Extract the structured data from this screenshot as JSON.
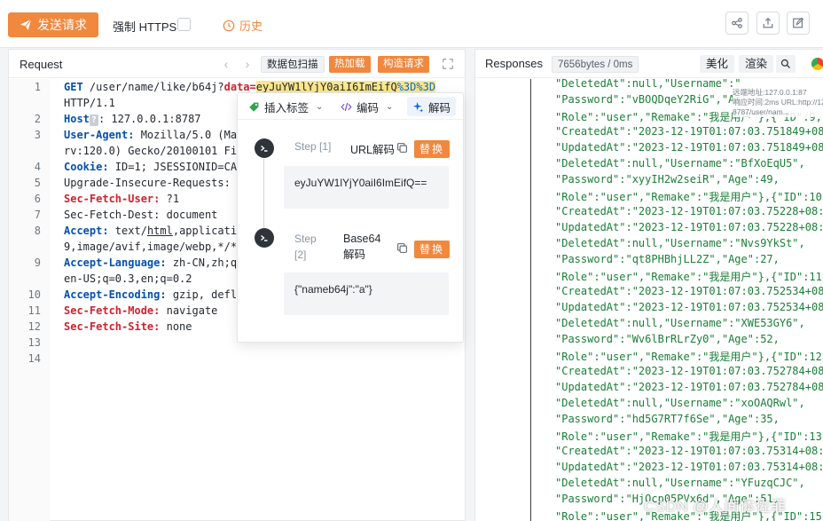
{
  "toolbar": {
    "send_label": "发送请求",
    "https_label": "强制 HTTPS",
    "https_checked": false,
    "history_label": "历史",
    "accent": "#f0883e"
  },
  "request": {
    "title": "Request",
    "buttons": {
      "scan": "数据包扫描",
      "hot_load": "热加载",
      "build": "构造请求"
    },
    "lines": [
      {
        "n": "1",
        "parts": [
          [
            "GET ",
            "k-blue"
          ],
          [
            "/user/name/like/b64j?",
            "k-plain"
          ],
          [
            "data=",
            "k-red"
          ],
          [
            "eyJuYW1lYjY0aiI6ImEifQ",
            "hl"
          ],
          [
            "%3D%3D",
            "hl-blue"
          ]
        ]
      },
      {
        "n": "",
        "parts": [
          [
            "HTTP/1.1",
            "k-plain"
          ]
        ]
      },
      {
        "n": "2",
        "parts": [
          [
            "Host",
            "k-blue"
          ]
        ],
        "badge": "?",
        "rest": [
          [
            ": 127.0.0.1:8787",
            "k-plain"
          ]
        ]
      },
      {
        "n": "3",
        "parts": [
          [
            "User-Agent:",
            "k-blue"
          ],
          [
            " Mozilla/5.0 (Ma",
            "k-plain"
          ]
        ]
      },
      {
        "n": "",
        "parts": [
          [
            "rv:120.0) Gecko/20100101 Fi",
            "k-plain"
          ]
        ]
      },
      {
        "n": "4",
        "parts": [
          [
            "Cookie:",
            "k-blue"
          ],
          [
            " ID=1; JSESSIONID=CA",
            "k-plain"
          ]
        ]
      },
      {
        "n": "5",
        "parts": [
          [
            "Upgrade-Insecure-Requests:",
            "k-plain"
          ]
        ]
      },
      {
        "n": "6",
        "parts": [
          [
            "Sec-Fetch-User:",
            "k-red"
          ],
          [
            " ?1",
            "k-plain"
          ]
        ]
      },
      {
        "n": "7",
        "parts": [
          [
            "Sec-Fetch-Dest:",
            "k-plain"
          ],
          [
            " document",
            "k-plain"
          ]
        ]
      },
      {
        "n": "8",
        "parts": [
          [
            "Accept:",
            "k-blue"
          ],
          [
            " text/",
            "k-plain"
          ],
          [
            "html",
            "ul"
          ],
          [
            ",applicati",
            "k-plain"
          ]
        ]
      },
      {
        "n": "",
        "parts": [
          [
            "9,image/avif,image/webp,*/*",
            "k-plain"
          ]
        ]
      },
      {
        "n": "9",
        "parts": [
          [
            "Accept-Language:",
            "k-blue"
          ],
          [
            " zh-CN,zh;q",
            "k-plain"
          ]
        ]
      },
      {
        "n": "",
        "parts": [
          [
            "en-US;q=0.3,en;q=0.2",
            "k-plain"
          ]
        ]
      },
      {
        "n": "10",
        "parts": [
          [
            "Accept-Encoding:",
            "k-blue"
          ],
          [
            " gzip, defl",
            "k-plain"
          ]
        ]
      },
      {
        "n": "11",
        "parts": [
          [
            "Sec-Fetch-Mode:",
            "k-red"
          ],
          [
            " navigate",
            "k-plain"
          ]
        ]
      },
      {
        "n": "12",
        "parts": [
          [
            "Sec-Fetch-Site:",
            "k-red"
          ],
          [
            " none",
            "k-plain"
          ]
        ]
      },
      {
        "n": "13",
        "parts": []
      },
      {
        "n": "14",
        "parts": []
      }
    ]
  },
  "decoder": {
    "tabs": {
      "insert_tag": "插入标签",
      "encode": "编码",
      "decode": "解码"
    },
    "steps": [
      {
        "step_label": "Step [1]",
        "name": "URL解码",
        "replace": "替换",
        "output": "eyJuYW1lYjY0aiI6ImEifQ=="
      },
      {
        "step_label": "Step [2]",
        "name": "Base64 解码",
        "replace": "替换",
        "output": "{\"nameb64j\":\"a\"}"
      }
    ]
  },
  "responses": {
    "title": "Responses",
    "size": "7656bytes / 0ms",
    "beautify": "美化",
    "render": "渲染",
    "lines": [
      "\"DeletedAt\":null,\"Username\":\"",
      "\"Password\":\"vBOQDqeY2RiG\",\"Ag",
      "\"Role\":\"user\",\"Remake\":\"我是用户\"},{\"ID\":9,",
      "\"CreatedAt\":\"2023-12-19T01:07:03.751849+08",
      "\"UpdatedAt\":\"2023-12-19T01:07:03.751849+08",
      "\"DeletedAt\":null,\"Username\":\"BfXoEqU5\",",
      "\"Password\":\"xyyIH2w2seiR\",\"Age\":49,",
      "\"Role\":\"user\",\"Remake\":\"我是用户\"},{\"ID\":10",
      "\"CreatedAt\":\"2023-12-19T01:07:03.75228+08:",
      "\"UpdatedAt\":\"2023-12-19T01:07:03.75228+08:",
      "\"DeletedAt\":null,\"Username\":\"Nvs9YkSt\",",
      "\"Password\":\"qt8PHBhjLL2Z\",\"Age\":27,",
      "\"Role\":\"user\",\"Remake\":\"我是用户\"},{\"ID\":11",
      "\"CreatedAt\":\"2023-12-19T01:07:03.752534+08",
      "\"UpdatedAt\":\"2023-12-19T01:07:03.752534+08",
      "\"DeletedAt\":null,\"Username\":\"XWE53GY6\",",
      "\"Password\":\"Wv6lBrRLrZy0\",\"Age\":52,",
      "\"Role\":\"user\",\"Remake\":\"我是用户\"},{\"ID\":12",
      "\"CreatedAt\":\"2023-12-19T01:07:03.752784+08",
      "\"UpdatedAt\":\"2023-12-19T01:07:03.752784+08",
      "\"DeletedAt\":null,\"Username\":\"xoOAQRwl\",",
      "\"Password\":\"hd5G7RT7f6Se\",\"Age\":35,",
      "\"Role\":\"user\",\"Remake\":\"我是用户\"},{\"ID\":13",
      "\"CreatedAt\":\"2023-12-19T01:07:03.75314+08:",
      "\"UpdatedAt\":\"2023-12-19T01:07:03.75314+08:",
      "\"DeletedAt\":null,\"Username\":\"YFuzqCJC\",",
      "\"Password\":\"HjOcp05PVx6d\",\"Age\":51,",
      "\"Role\":\"user\",\"Remake\":\"我是用户\"},{\"ID\":15"
    ],
    "tooltip": [
      "远端地址:127.0.0.1:87",
      "响应时间:2ms URL:http://12",
      "8787/user/nam..."
    ]
  },
  "watermark": "CSDN @人间体佐菲"
}
